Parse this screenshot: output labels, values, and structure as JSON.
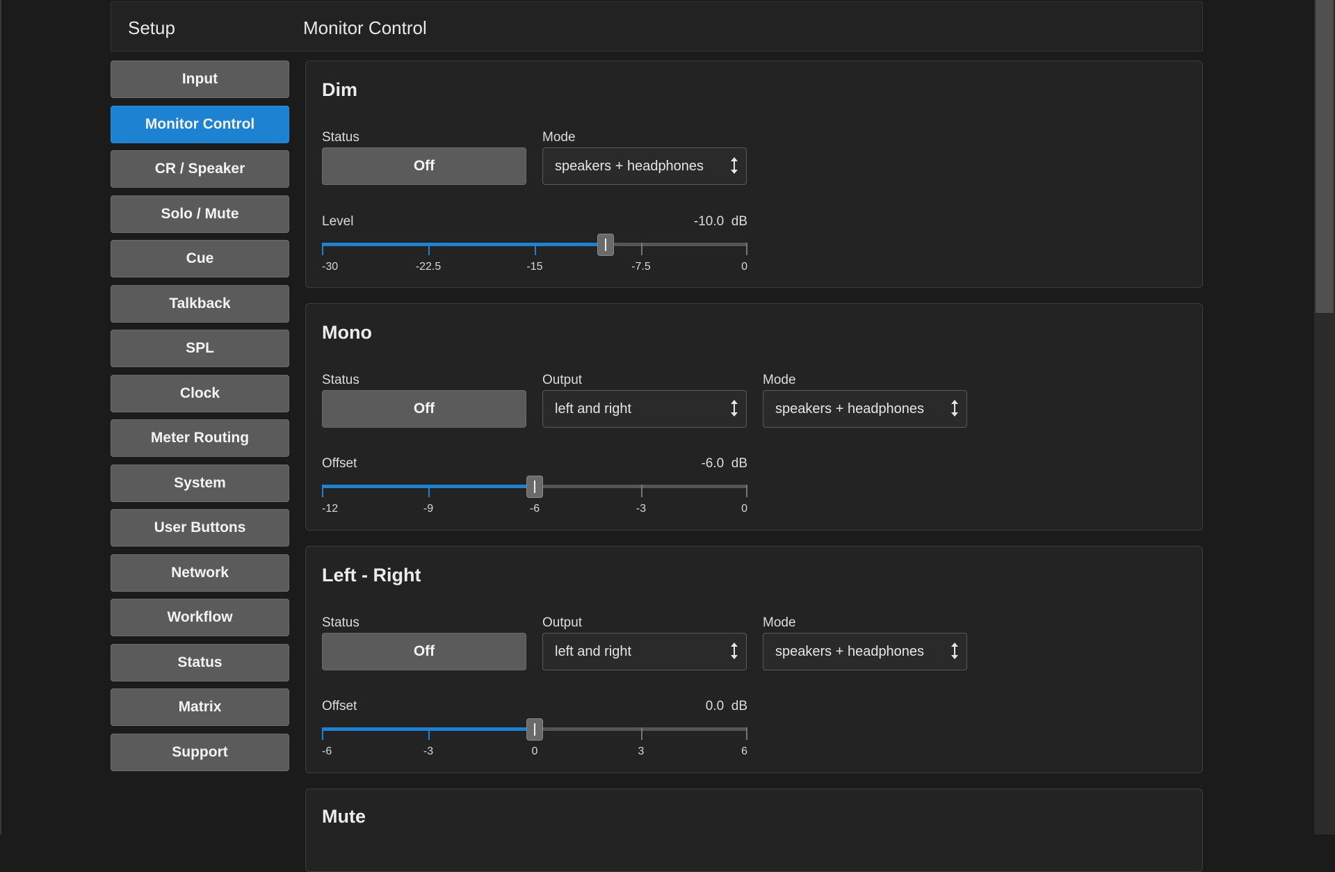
{
  "header": {
    "setup_label": "Setup",
    "page_title": "Monitor Control"
  },
  "sidebar": {
    "items": [
      {
        "label": "Input",
        "active": false
      },
      {
        "label": "Monitor Control",
        "active": true
      },
      {
        "label": "CR / Speaker",
        "active": false
      },
      {
        "label": "Solo / Mute",
        "active": false
      },
      {
        "label": "Cue",
        "active": false
      },
      {
        "label": "Talkback",
        "active": false
      },
      {
        "label": "SPL",
        "active": false
      },
      {
        "label": "Clock",
        "active": false
      },
      {
        "label": "Meter Routing",
        "active": false
      },
      {
        "label": "System",
        "active": false
      },
      {
        "label": "User Buttons",
        "active": false
      },
      {
        "label": "Network",
        "active": false
      },
      {
        "label": "Workflow",
        "active": false
      },
      {
        "label": "Status",
        "active": false
      },
      {
        "label": "Matrix",
        "active": false
      },
      {
        "label": "Support",
        "active": false
      }
    ]
  },
  "panels": {
    "dim": {
      "title": "Dim",
      "status_label": "Status",
      "status_value": "Off",
      "mode_label": "Mode",
      "mode_value": "speakers + headphones",
      "level_label": "Level",
      "level_value": "-10.0",
      "unit": "dB",
      "slider": {
        "min": -30,
        "max": 0,
        "value": -10,
        "ticks": [
          "-30",
          "-22.5",
          "-15",
          "-7.5",
          "0"
        ]
      }
    },
    "mono": {
      "title": "Mono",
      "status_label": "Status",
      "status_value": "Off",
      "output_label": "Output",
      "output_value": "left and right",
      "mode_label": "Mode",
      "mode_value": "speakers + headphones",
      "offset_label": "Offset",
      "offset_value": "-6.0",
      "unit": "dB",
      "slider": {
        "min": -12,
        "max": 0,
        "value": -6,
        "ticks": [
          "-12",
          "-9",
          "-6",
          "-3",
          "0"
        ]
      }
    },
    "left_right": {
      "title": "Left - Right",
      "status_label": "Status",
      "status_value": "Off",
      "output_label": "Output",
      "output_value": "left and right",
      "mode_label": "Mode",
      "mode_value": "speakers + headphones",
      "offset_label": "Offset",
      "offset_value": "0.0",
      "unit": "dB",
      "slider": {
        "min": -6,
        "max": 6,
        "value": 0,
        "ticks": [
          "-6",
          "-3",
          "0",
          "3",
          "6"
        ]
      }
    },
    "mute": {
      "title": "Mute"
    }
  },
  "colors": {
    "accent": "#1e82d2",
    "button": "#5b5b5b",
    "panel": "#232323",
    "background": "#1b1b1b"
  }
}
